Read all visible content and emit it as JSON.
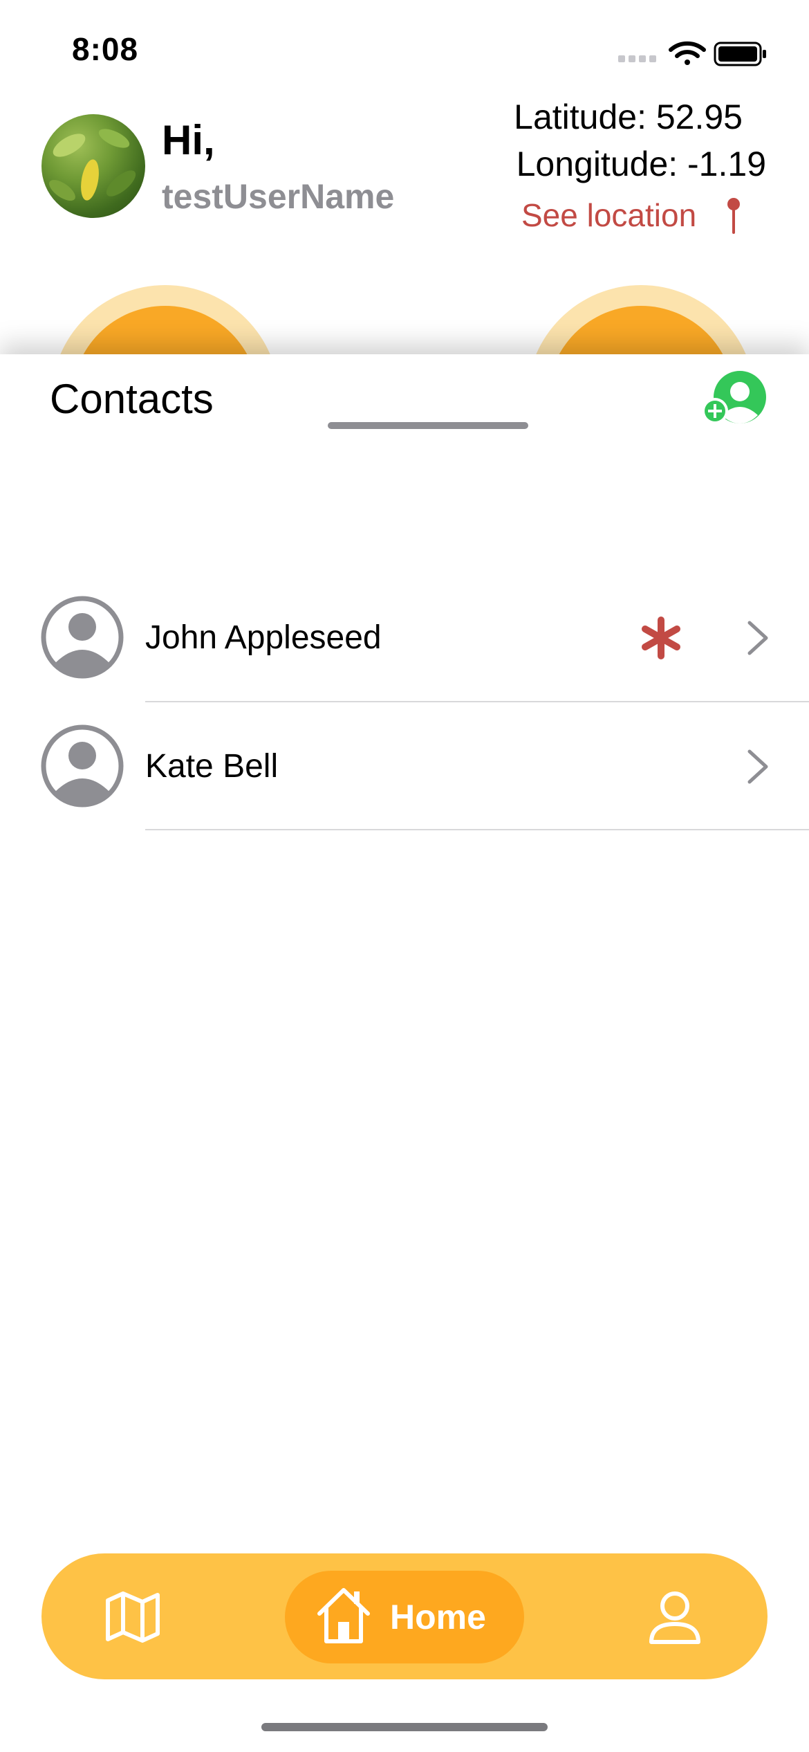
{
  "status_bar": {
    "time": "8:08"
  },
  "header": {
    "greeting": "Hi,",
    "username": "testUserName",
    "latitude_text": "Latitude: 52.95",
    "longitude_text": "Longitude:  -1.19",
    "see_location": "See location"
  },
  "contacts": {
    "title": "Contacts",
    "items": [
      {
        "name": "John Appleseed",
        "flagged": true
      },
      {
        "name": "Kate Bell",
        "flagged": false
      }
    ]
  },
  "tab_bar": {
    "active_label": "Home",
    "tabs": [
      "map",
      "home",
      "profile"
    ]
  },
  "colors": {
    "accent_orange": "#fea81f",
    "tabbar_yellow": "#fec246",
    "alert_red": "#c24a44",
    "add_green": "#34c759",
    "gray": "#8e8e93"
  }
}
